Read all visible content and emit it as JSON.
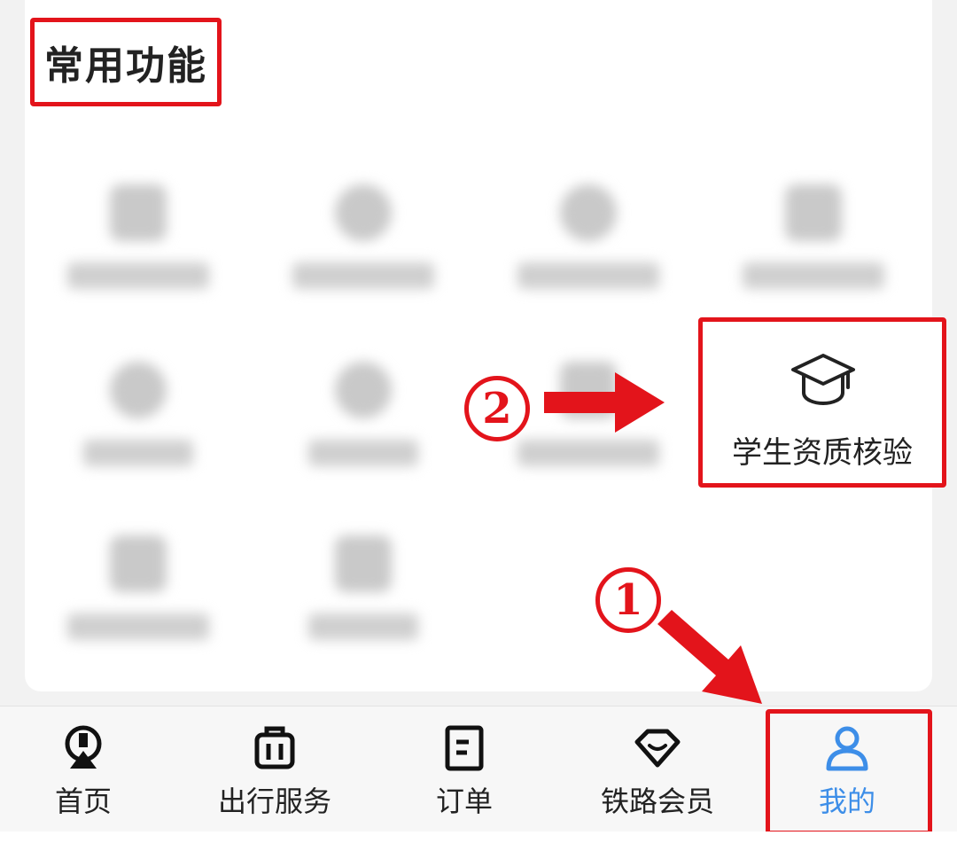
{
  "section": {
    "title": "常用功能"
  },
  "highlighted_feature": {
    "label": "学生资质核验",
    "icon": "graduation-cap-icon"
  },
  "annotations": {
    "step1": "1",
    "step2": "2",
    "highlight_color": "#e3141b"
  },
  "tabbar": {
    "active_color": "#3d8ee8",
    "tabs": [
      {
        "label": "首页",
        "icon": "railway-logo-icon"
      },
      {
        "label": "出行服务",
        "icon": "luggage-icon"
      },
      {
        "label": "订单",
        "icon": "order-document-icon"
      },
      {
        "label": "铁路会员",
        "icon": "diamond-icon"
      },
      {
        "label": "我的",
        "icon": "user-icon",
        "active": true
      }
    ]
  }
}
